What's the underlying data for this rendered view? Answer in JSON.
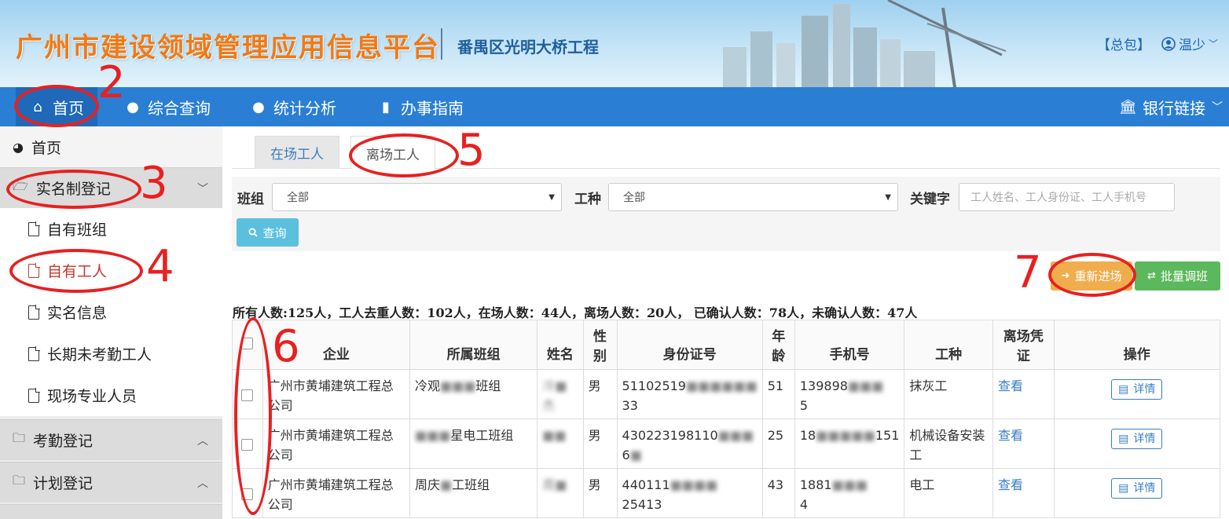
{
  "header": {
    "title": "广州市建设领域管理应用信息平台",
    "project": "番禺区光明大桥工程",
    "package_link": "【总包】",
    "user": "温少"
  },
  "nav": {
    "items": [
      {
        "label": "首页",
        "icon": "home-icon"
      },
      {
        "label": "综合查询",
        "icon": "globe-icon"
      },
      {
        "label": "统计分析",
        "icon": "globe-icon"
      },
      {
        "label": "办事指南",
        "icon": "book-icon"
      }
    ],
    "bank_links": "银行链接"
  },
  "sidebar": {
    "home": "首页",
    "realname_group": "实名制登记",
    "sub_items": [
      "自有班组",
      "自有工人",
      "实名信息",
      "长期未考勤工人",
      "现场专业人员"
    ],
    "attendance_group": "考勤登记",
    "plan_group": "计划登记"
  },
  "tabs": {
    "onsite": "在场工人",
    "offsite": "离场工人"
  },
  "filter": {
    "team_label": "班组",
    "team_value": "全部",
    "worktype_label": "工种",
    "worktype_value": "全部",
    "keyword_label": "关键字",
    "keyword_placeholder": "工人姓名、工人身份证、工人手机号",
    "query_button": "查询"
  },
  "actions": {
    "reenter": "重新进场",
    "batch": "批量调班"
  },
  "stats": "所有人数:125人，工人去重人数：102人，在场人数：44人，离场人数：20人， 已确认人数：78人，未确认人数：47人",
  "table": {
    "headers": [
      "企业",
      "所属班组",
      "姓名",
      "性别",
      "身份证号",
      "年龄",
      "手机号",
      "工种",
      "离场凭证",
      "操作"
    ],
    "rows": [
      {
        "company": "广州市黄埔建筑工程总公司",
        "team_a": "冷观",
        "team_b": "班组",
        "name_a": "冷",
        "name_b": "杰",
        "gender": "男",
        "id_a": "51102519",
        "id_b": "33",
        "age": "51",
        "phone_a": "139898",
        "phone_b": "5",
        "worktype": "抹灰工",
        "voucher": "查看",
        "action": "详情"
      },
      {
        "company": "广州市黄埔建筑工程总公司",
        "team_a": "",
        "team_b": "星电工班组",
        "name_a": "",
        "name_b": "",
        "gender": "男",
        "id_a": "430223198110",
        "id_b": "6",
        "age": "25",
        "phone_a": "18",
        "phone_b": "151",
        "worktype": "机械设备安装工",
        "voucher": "查看",
        "action": "详情"
      },
      {
        "company": "广州市黄埔建筑工程总公司",
        "team_a": "周庆",
        "team_b": "工班组",
        "name_a": "周",
        "name_b": "",
        "gender": "男",
        "id_a": "440111",
        "id_b": "25413",
        "age": "43",
        "phone_a": "1881",
        "phone_b": "4",
        "worktype": "电工",
        "voucher": "查看",
        "action": "详情"
      }
    ]
  },
  "annotations": [
    "2",
    "3",
    "4",
    "5",
    "6",
    "7"
  ]
}
